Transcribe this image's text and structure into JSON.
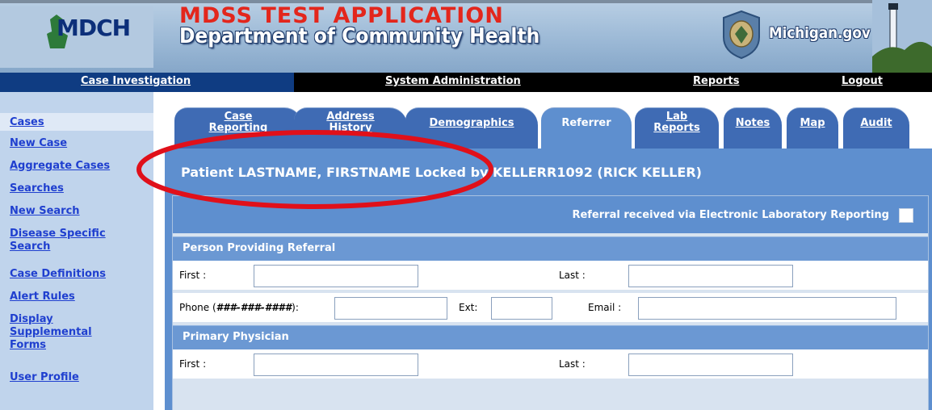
{
  "header": {
    "logo_text": "MDCH",
    "app_title": "MDSS TEST APPLICATION",
    "department": "Department of Community Health",
    "michigan_gov": "Michigan.gov"
  },
  "topnav": {
    "items": [
      {
        "label": "Case Investigation"
      },
      {
        "label": "System Administration"
      },
      {
        "label": "Reports"
      },
      {
        "label": "Logout"
      }
    ]
  },
  "sidebar": {
    "items": [
      {
        "label": "Cases"
      },
      {
        "label": "New Case"
      },
      {
        "label": "Aggregate Cases"
      },
      {
        "label": "Searches"
      },
      {
        "label": "New Search"
      },
      {
        "label": "Disease Specific Search"
      },
      {
        "label": "Case Definitions"
      },
      {
        "label": "Alert Rules"
      },
      {
        "label": "Display Supplemental Forms"
      },
      {
        "label": "User Profile"
      }
    ]
  },
  "tabs": {
    "items": [
      {
        "label": "Case Reporting"
      },
      {
        "label": "Address History"
      },
      {
        "label": "Demographics"
      },
      {
        "label": "Referrer"
      },
      {
        "label": "Lab Reports"
      },
      {
        "label": "Notes"
      },
      {
        "label": "Map"
      },
      {
        "label": "Audit"
      }
    ],
    "active": "Referrer"
  },
  "main": {
    "patient_line": "Patient LASTNAME, FIRSTNAME Locked by KELLERR1092 (RICK KELLER)",
    "elr_label": "Referral received via Electronic Laboratory Reporting",
    "elr_checked": false,
    "person_section": "Person Providing Referral",
    "physician_section": "Primary Physician",
    "first_label": "First :",
    "last_label": "Last :",
    "phone_label_prefix": "Phone (",
    "phone_label_format": "###-###-####",
    "phone_label_suffix": "):",
    "ext_label": "Ext:",
    "email_label": "Email :"
  },
  "colors": {
    "nav_blue": "#0f3c82",
    "tab_blue": "#3f6bb4",
    "panel_blue": "#5e8fcf",
    "sidebar_bg": "#c0d4ec",
    "link_blue": "#1f3fcf",
    "annotation_red": "#e0101a",
    "title_red": "#e3261c"
  }
}
